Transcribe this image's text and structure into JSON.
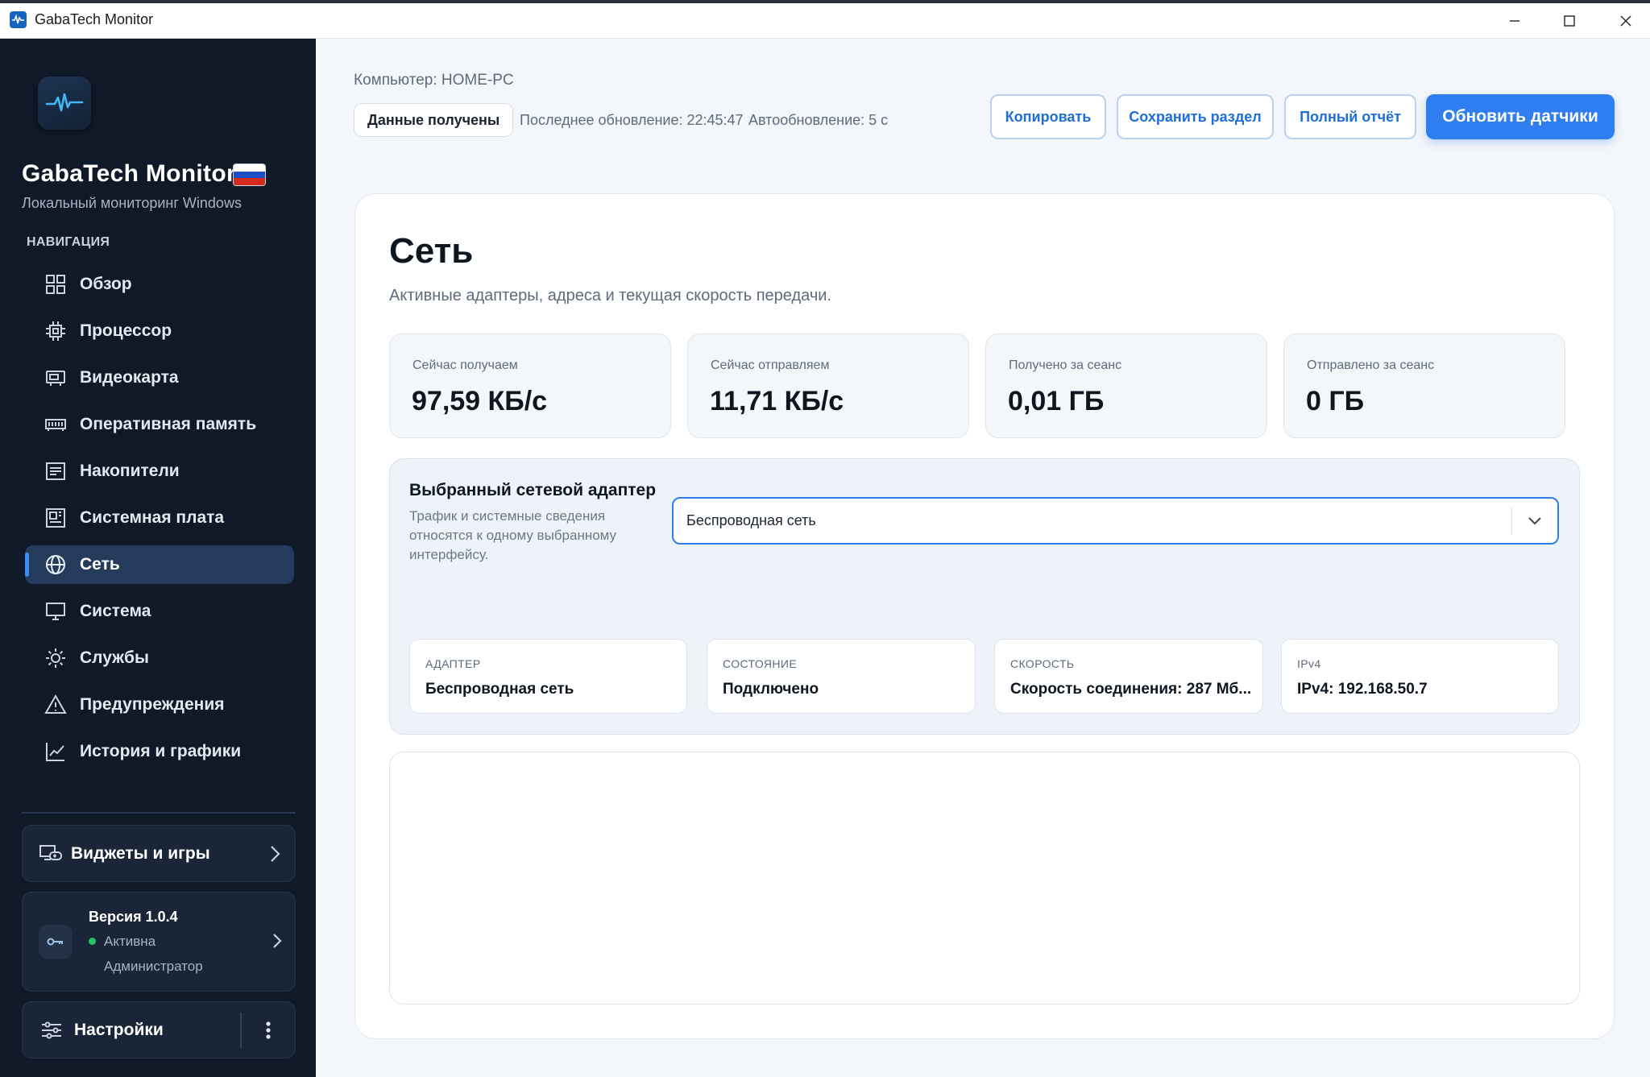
{
  "window": {
    "title": "GabaTech Monitor"
  },
  "sidebar": {
    "app_name": "GabaTech Monitor",
    "app_subtitle": "Локальный мониторинг Windows",
    "nav_heading": "НАВИГАЦИЯ",
    "items": [
      {
        "label": "Обзор",
        "icon": "grid-icon"
      },
      {
        "label": "Процессор",
        "icon": "cpu-icon"
      },
      {
        "label": "Видеокарта",
        "icon": "gpu-icon"
      },
      {
        "label": "Оперативная память",
        "icon": "ram-icon"
      },
      {
        "label": "Накопители",
        "icon": "drive-icon"
      },
      {
        "label": "Системная плата",
        "icon": "motherboard-icon"
      },
      {
        "label": "Сеть",
        "icon": "globe-icon",
        "active": true
      },
      {
        "label": "Система",
        "icon": "monitor-icon"
      },
      {
        "label": "Службы",
        "icon": "gear-icon"
      },
      {
        "label": "Предупреждения",
        "icon": "warning-icon"
      },
      {
        "label": "История и графики",
        "icon": "chart-icon"
      }
    ],
    "widgets_label": "Виджеты и игры",
    "license": {
      "version": "Версия 1.0.4",
      "status": "Активна",
      "role": "Администратор",
      "status_color": "#22c55e"
    },
    "settings_label": "Настройки"
  },
  "header": {
    "computer": "Компьютер: HOME-PC",
    "status_pill": "Данные получены",
    "last_update": "Последнее обновление: 22:45:47",
    "auto_update": "Автообновление: 5 с",
    "buttons": {
      "copy": "Копировать",
      "save_section": "Сохранить раздел",
      "full_report": "Полный отчёт",
      "refresh": "Обновить датчики"
    }
  },
  "main": {
    "title": "Сеть",
    "description": "Активные адаптеры, адреса и текущая скорость передачи.",
    "stats": [
      {
        "label": "Сейчас получаем",
        "value": "97,59 КБ/с"
      },
      {
        "label": "Сейчас отправляем",
        "value": "11,71 КБ/с"
      },
      {
        "label": "Получено за сеанс",
        "value": "0,01 ГБ"
      },
      {
        "label": "Отправлено за сеанс",
        "value": "0 ГБ"
      }
    ],
    "adapter": {
      "title": "Выбранный сетевой адаптер",
      "description": "Трафик и системные сведения относятся к одному выбранному интерфейсу.",
      "selected": "Беспроводная сеть",
      "tiles": [
        {
          "label": "АДАПТЕР",
          "value": "Беспроводная сеть"
        },
        {
          "label": "СОСТОЯНИЕ",
          "value": "Подключено"
        },
        {
          "label": "СКОРОСТЬ",
          "value": "Скорость соединения: 287 Мб..."
        },
        {
          "label": "IPv4",
          "value": "IPv4: 192.168.50.7"
        }
      ]
    }
  },
  "colors": {
    "accent": "#2f7ef0",
    "sidebar_bg": "#0f1928",
    "active_nav": "#243b5c"
  }
}
